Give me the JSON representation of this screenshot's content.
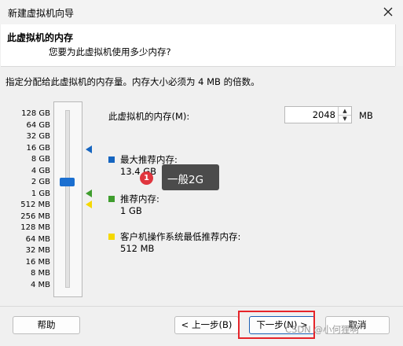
{
  "window": {
    "title": "新建虚拟机向导"
  },
  "header": {
    "title": "此虚拟机的内存",
    "subtitle": "您要为此虚拟机使用多少内存?"
  },
  "instruction": "指定分配给此虚拟机的内存量。内存大小必须为 4 MB 的倍数。",
  "slider": {
    "ticks": [
      "128 GB",
      "64 GB",
      "32 GB",
      "16 GB",
      "8 GB",
      "4 GB",
      "2 GB",
      "1 GB",
      "512 MB",
      "256 MB",
      "128 MB",
      "64 MB",
      "32 MB",
      "16 MB",
      "8 MB",
      "4 MB"
    ],
    "selected": "2 GB"
  },
  "memory": {
    "label": "此虚拟机的内存(M):",
    "value": "2048",
    "unit": "MB"
  },
  "legend": [
    {
      "title": "最大推荐内存:",
      "value": "13.4 GB",
      "color": "#1565c0"
    },
    {
      "title": "推荐内存:",
      "value": "1 GB",
      "color": "#3f9d2e"
    },
    {
      "title": "客户机操作系统最低推荐内存:",
      "value": "512 MB",
      "color": "#f5d800"
    }
  ],
  "annotation": {
    "badge": "1",
    "text": "一般2G"
  },
  "buttons": {
    "help": "帮助",
    "back": "< 上一步(B)",
    "next": "下一步(N) >",
    "cancel": "取消"
  },
  "watermark": "CSDN @小何狸啊",
  "colors": {
    "accent": "#1b6fd0",
    "highlight": "#e6242a"
  }
}
